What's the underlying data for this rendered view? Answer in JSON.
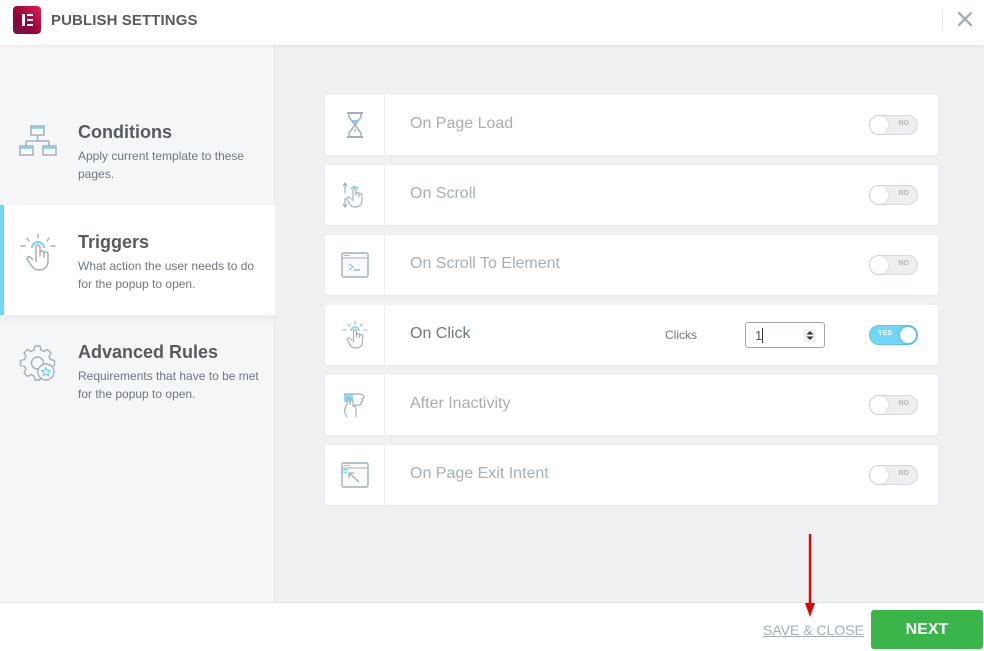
{
  "header": {
    "title": "PUBLISH SETTINGS",
    "logo_icon": "elementor-logo",
    "close_icon": "close-x"
  },
  "sidebar": {
    "items": [
      {
        "title": "Conditions",
        "description": "Apply current template to these pages.",
        "icon": "sitemap-icon",
        "active": false
      },
      {
        "title": "Triggers",
        "description": "What action the user needs to do for the popup to open.",
        "icon": "tap-icon",
        "active": true
      },
      {
        "title": "Advanced Rules",
        "description": "Requirements that have to be met for the popup to open.",
        "icon": "gear-star-icon",
        "active": false
      }
    ]
  },
  "triggers": [
    {
      "label": "On Page Load",
      "icon": "hourglass-icon",
      "enabled": false,
      "toggle_text": "NO"
    },
    {
      "label": "On Scroll",
      "icon": "scroll-hand-icon",
      "enabled": false,
      "toggle_text": "NO"
    },
    {
      "label": "On Scroll To Element",
      "icon": "terminal-window-icon",
      "enabled": false,
      "toggle_text": "NO"
    },
    {
      "label": "On Click",
      "icon": "tap-icon",
      "enabled": true,
      "toggle_text": "YES",
      "setting_label": "Clicks",
      "setting_value": "1"
    },
    {
      "label": "After Inactivity",
      "icon": "inactive-hand-icon",
      "enabled": false,
      "toggle_text": "NO"
    },
    {
      "label": "On Page Exit Intent",
      "icon": "exit-window-icon",
      "enabled": false,
      "toggle_text": "NO"
    }
  ],
  "footer": {
    "save_close_label": "SAVE & CLOSE",
    "next_label": "NEXT"
  },
  "colors": {
    "accent": "#71d7f7",
    "next_button": "#39b54a",
    "annotation_arrow": "#e60000"
  }
}
